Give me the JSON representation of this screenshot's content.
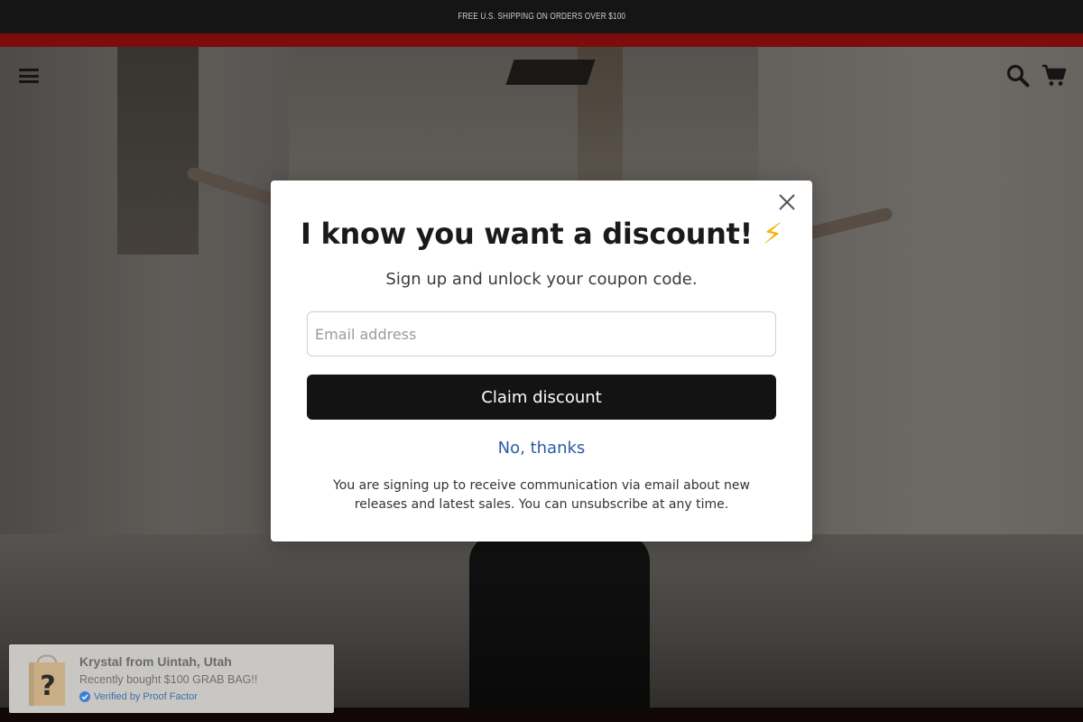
{
  "announcement": {
    "text": "FREE U.S. SHIPPING ON ORDERS OVER $100"
  },
  "header": {
    "menu_icon": "hamburger-menu-icon",
    "search_icon": "search-icon",
    "cart_icon": "cart-icon"
  },
  "modal": {
    "title": "I know you want a discount!",
    "title_emoji": "⚡",
    "subtitle": "Sign up and unlock your coupon code.",
    "email_placeholder": "Email address",
    "email_value": "",
    "claim_label": "Claim discount",
    "decline_label": "No, thanks",
    "legal_text": "You are signing up to receive communication via email about new releases and latest sales. You can unsubscribe at any time."
  },
  "social_proof": {
    "name": "Krystal from Uintah, Utah",
    "purchase": "Recently bought $100 GRAB BAG!!",
    "verified": "Verified by Proof Factor"
  },
  "colors": {
    "announcement_bg": "#151515",
    "accent_bar": "#7d0c0c",
    "button_bg": "#131313",
    "link": "#2b5aa8",
    "verified": "#3d6fa8"
  }
}
